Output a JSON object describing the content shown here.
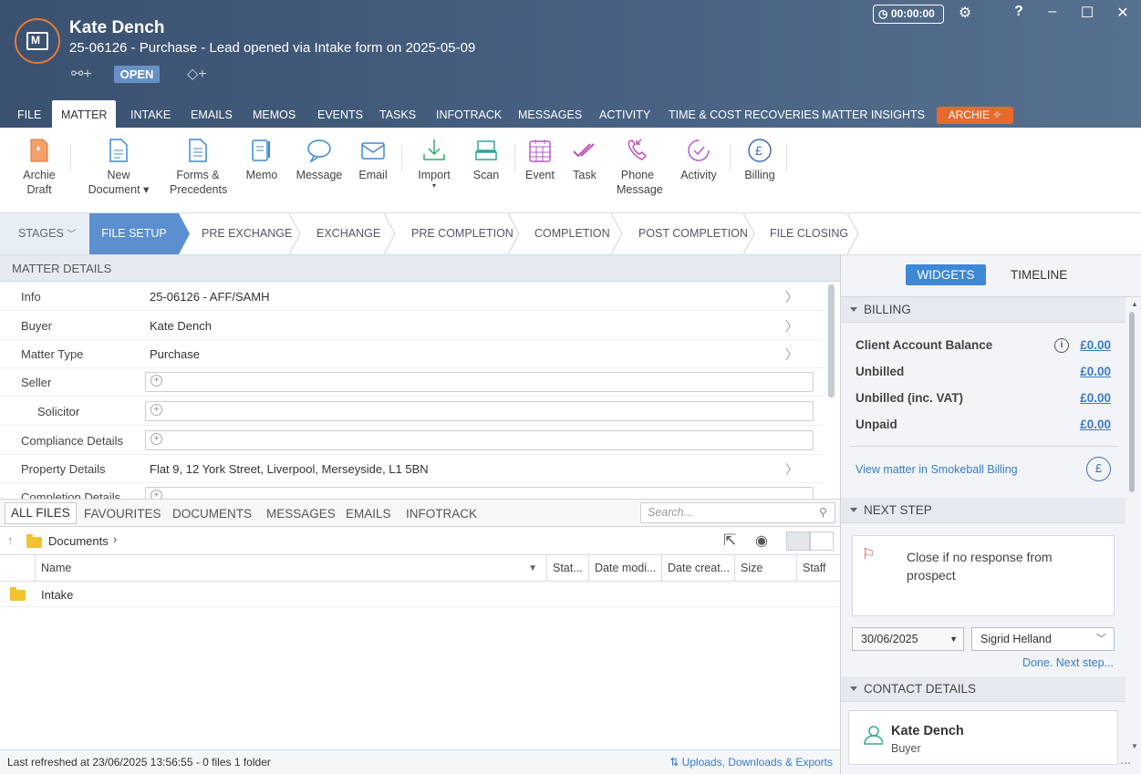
{
  "header": {
    "client_name": "Kate Dench",
    "matter_subtitle": "25-06126 - Purchase - Lead opened via Intake form on 2025-05-09",
    "status_badge": "OPEN",
    "timer": "00:00:00"
  },
  "window_controls": {
    "help": "?",
    "minimize": "–",
    "maximize": "☐",
    "close": "✕"
  },
  "tabs": [
    "FILE",
    "MATTER",
    "INTAKE",
    "EMAILS",
    "MEMOS",
    "EVENTS",
    "TASKS",
    "INFOTRACK",
    "MESSAGES",
    "ACTIVITY",
    "TIME & COST RECOVERIES",
    "MATTER INSIGHTS",
    "ARCHIE"
  ],
  "ribbon": {
    "archie_draft": [
      "Archie",
      "Draft"
    ],
    "new_document": [
      "New",
      "Document ▾"
    ],
    "forms": [
      "Forms &",
      "Precedents"
    ],
    "memo": "Memo",
    "message": "Message",
    "email": "Email",
    "import": "Import",
    "scan": "Scan",
    "event": "Event",
    "task": "Task",
    "phone_message": [
      "Phone",
      "Message"
    ],
    "activity": "Activity",
    "billing": "Billing"
  },
  "stages": {
    "label": "STAGES",
    "active": "FILE SETUP",
    "items": [
      "PRE EXCHANGE",
      "EXCHANGE",
      "PRE COMPLETION",
      "COMPLETION",
      "POST COMPLETION",
      "FILE CLOSING"
    ]
  },
  "matter_details": {
    "title": "MATTER DETAILS",
    "rows": [
      {
        "label": "Info",
        "value": "25-06126 - AFF/SAMH"
      },
      {
        "label": "Buyer",
        "value": "Kate Dench"
      },
      {
        "label": "Matter Type",
        "value": "Purchase"
      },
      {
        "label": "Seller",
        "value": ""
      },
      {
        "label": "Solicitor",
        "value": ""
      },
      {
        "label": "Compliance Details",
        "value": ""
      },
      {
        "label": "Property Details",
        "value": "Flat 9, 12 York Street, Liverpool, Merseyside, L1 5BN"
      },
      {
        "label": "Completion Details",
        "value": ""
      }
    ]
  },
  "files": {
    "tabs": [
      "ALL FILES",
      "FAVOURITES",
      "DOCUMENTS",
      "MESSAGES",
      "EMAILS",
      "INFOTRACK"
    ],
    "search_placeholder": "Search...",
    "breadcrumb": "Documents",
    "columns": [
      "Name",
      "Stat...",
      "Date modi...",
      "Date creat...",
      "Size",
      "Staff"
    ],
    "rows": [
      {
        "name": "Intake"
      }
    ],
    "status": "Last refreshed at 23/06/2025 13:56:55  -  0 files  1 folder",
    "uploads_link": "Uploads, Downloads & Exports"
  },
  "right_panel": {
    "widgets_tab": "WIDGETS",
    "timeline_tab": "TIMELINE",
    "billing": {
      "title": "BILLING",
      "rows": [
        {
          "label": "Client Account Balance",
          "value": "£0.00"
        },
        {
          "label": "Unbilled",
          "value": "£0.00"
        },
        {
          "label": "Unbilled (inc. VAT)",
          "value": "£0.00"
        },
        {
          "label": "Unpaid",
          "value": "£0.00"
        }
      ],
      "link": "View matter in Smokeball Billing"
    },
    "next_step": {
      "title": "NEXT STEP",
      "text": "Close if no response from prospect",
      "date": "30/06/2025",
      "staff": "Sigrid Helland",
      "done_link": "Done. Next step..."
    },
    "contact": {
      "title": "CONTACT DETAILS",
      "name": "Kate Dench",
      "role": "Buyer"
    }
  },
  "colors": {
    "header": "#3a5170",
    "accent": "#3f88d6",
    "stage_active": "#5b8fd0",
    "archie": "#e8692e"
  }
}
